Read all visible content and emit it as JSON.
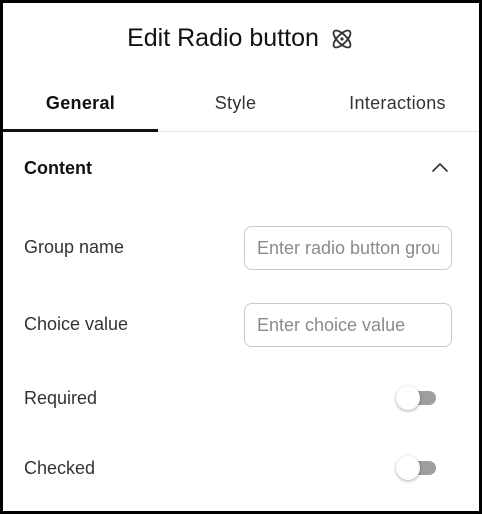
{
  "panel": {
    "title": "Edit Radio button",
    "title_icon": "atom-icon"
  },
  "tabs": [
    {
      "label": "General",
      "active": true
    },
    {
      "label": "Style",
      "active": false
    },
    {
      "label": "Interactions",
      "active": false
    }
  ],
  "content_section": {
    "title": "Content",
    "expanded": true,
    "collapse_icon": "chevron-up-icon"
  },
  "fields": {
    "group_name": {
      "label": "Group name",
      "value": "",
      "placeholder": "Enter radio button group"
    },
    "choice_value": {
      "label": "Choice value",
      "value": "",
      "placeholder": "Enter choice value"
    },
    "required": {
      "label": "Required",
      "on": false
    },
    "checked": {
      "label": "Checked",
      "on": false
    }
  },
  "colors": {
    "accent": "#111111",
    "toggle_track_off": "#9e9e9e",
    "frame_border": "#000000"
  }
}
